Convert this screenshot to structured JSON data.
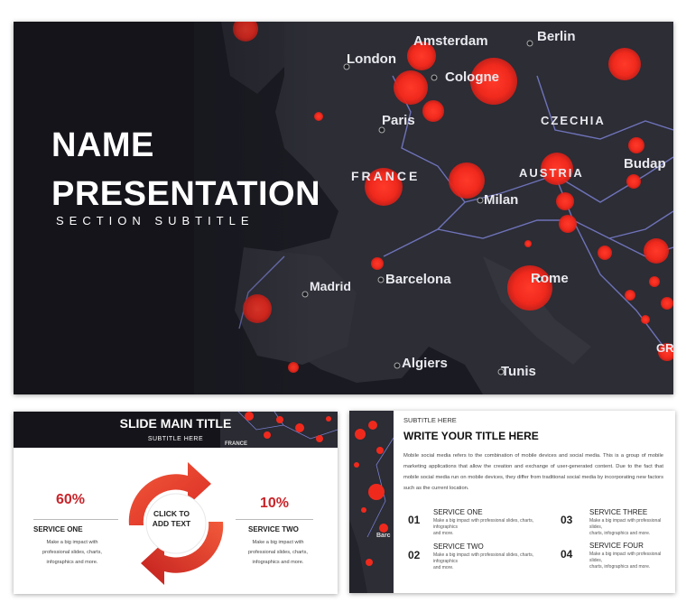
{
  "main_slide": {
    "title_line1": "NAME",
    "title_line2": "PRESENTATION",
    "subtitle": "SECTION SUBTITLE",
    "map_labels": [
      "Amsterdam",
      "Berlin",
      "London",
      "Cologne",
      "Paris",
      "CZECHIA",
      "FRANCE",
      "AUSTRIA",
      "Budap",
      "Milan",
      "Barcelona",
      "Madrid",
      "Rome",
      "Algiers",
      "Tunis",
      "GRE"
    ]
  },
  "cycle_slide": {
    "title": "SLIDE MAIN TITLE",
    "subtitle": "SUBTITLE HERE",
    "header_labels": [
      "FRANCE"
    ],
    "center_text_line1": "CLICK TO",
    "center_text_line2": "ADD TEXT",
    "left": {
      "percent": "60%",
      "name": "SERVICE ONE",
      "desc_line1": "Make a big impact with",
      "desc_line2": "professional slides, charts,",
      "desc_line3": "infographics and more."
    },
    "right": {
      "percent": "10%",
      "name": "SERVICE TWO",
      "desc_line1": "Make a big impact with",
      "desc_line2": "professional slides, charts,",
      "desc_line3": "infographics and more."
    },
    "accent_color": "#c9242a"
  },
  "services_slide": {
    "subtitle": "SUBTITLE HERE",
    "title": "WRITE YOUR TITLE HERE",
    "body": "Mobile social media refers to the combination of mobile devices and social media. This is a group of mobile marketing applications that allow the creation and exchange of user-generated content. Due to the fact that mobile social media run on mobile devices, they differ from traditional social media by incorporating new factors such as the current location.",
    "strip_labels": [
      "Barc"
    ],
    "services": [
      {
        "num": "01",
        "name": "SERVICE ONE",
        "desc_line1": "Make a big impact with professional slides, charts, infographics",
        "desc_line2": "and more."
      },
      {
        "num": "02",
        "name": "SERVICE TWO",
        "desc_line1": "Make a big impact with professional slides, charts, infographics",
        "desc_line2": "and more."
      },
      {
        "num": "03",
        "name": "SERVICE THREE",
        "desc_line1": "Make a big impact with professional slides,",
        "desc_line2": "charts, infographics and more."
      },
      {
        "num": "04",
        "name": "SERVICE FOUR",
        "desc_line1": "Make a big impact with professional slides,",
        "desc_line2": "charts, infographics and more."
      }
    ]
  }
}
